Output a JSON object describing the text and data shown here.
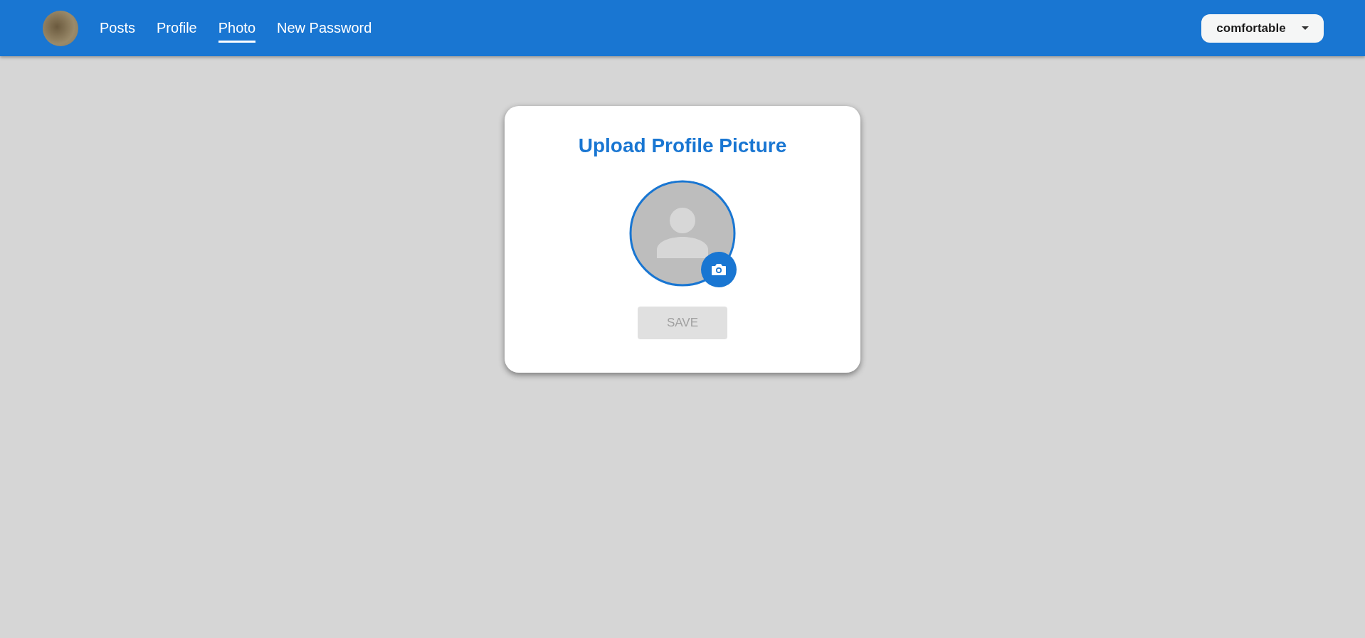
{
  "header": {
    "tabs": [
      {
        "label": "Posts",
        "selected": false
      },
      {
        "label": "Profile",
        "selected": false
      },
      {
        "label": "Photo",
        "selected": true
      },
      {
        "label": "New Password",
        "selected": false
      }
    ],
    "density_select": {
      "value": "comfortable"
    }
  },
  "card": {
    "title": "Upload Profile Picture",
    "save_button": {
      "label": "SAVE",
      "disabled": true
    }
  }
}
